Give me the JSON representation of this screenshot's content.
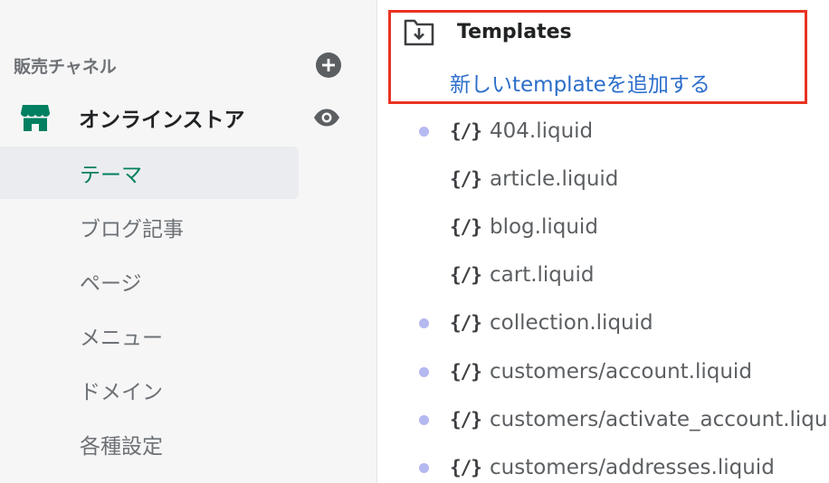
{
  "sidebar": {
    "section_title": "販売チャネル",
    "add_icon": "plus-circle-icon",
    "channel": {
      "name": "オンラインストア",
      "icon": "store-icon",
      "view_icon": "eye-icon",
      "brand_color": "#008060"
    },
    "items": [
      {
        "label": "テーマ",
        "active": true
      },
      {
        "label": "ブログ記事",
        "active": false
      },
      {
        "label": "ページ",
        "active": false
      },
      {
        "label": "メニュー",
        "active": false
      },
      {
        "label": "ドメイン",
        "active": false
      },
      {
        "label": "各種設定",
        "active": false
      }
    ]
  },
  "templates": {
    "folder_icon": "folder-download-icon",
    "title": "Templates",
    "add_link": "新しいtemplateを追加する",
    "highlight_color": "#e93323",
    "code_icon_glyph": "{/}",
    "files": [
      {
        "name": "404.liquid",
        "modified": true
      },
      {
        "name": "article.liquid",
        "modified": false
      },
      {
        "name": "blog.liquid",
        "modified": false
      },
      {
        "name": "cart.liquid",
        "modified": false
      },
      {
        "name": "collection.liquid",
        "modified": true
      },
      {
        "name": "customers/account.liquid",
        "modified": true
      },
      {
        "name": "customers/activate_account.liquid",
        "modified": true
      },
      {
        "name": "customers/addresses.liquid",
        "modified": true
      }
    ]
  }
}
